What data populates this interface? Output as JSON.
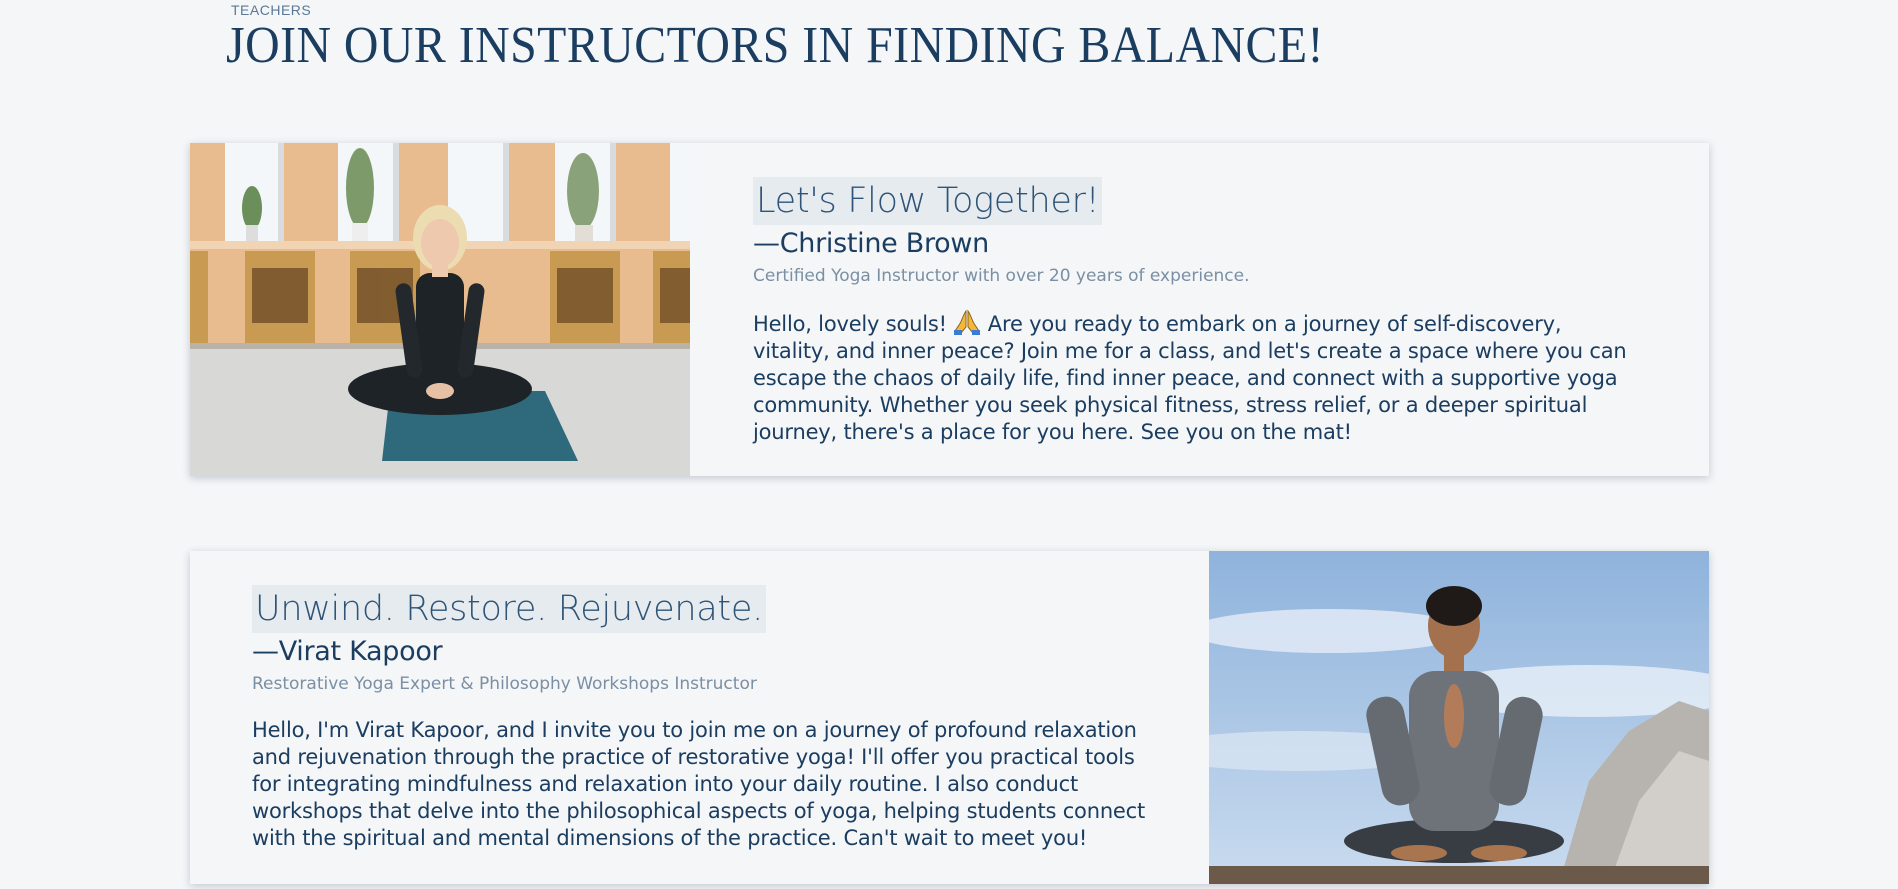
{
  "header": {
    "section_label": "TEACHERS",
    "title": "JOIN OUR INSTRUCTORS IN FINDING BALANCE!"
  },
  "instructors": [
    {
      "tagline": "Let's Flow Together!",
      "name": "—Christine Brown",
      "credentials": "Certified Yoga Instructor with over 20 years of experience.",
      "bio_before_emoji": "Hello, lovely souls! ",
      "bio_after_emoji": " Are you ready to embark on a journey of self-discovery, vitality, and inner peace? Join me for a class, and let's create a space where you can escape the chaos of daily life, find inner peace, and connect with a supportive yoga community. Whether you seek physical fitness, stress relief, or a deeper spiritual journey, there's a place for you here. See you on the mat!",
      "emoji_icon": "folded-hands-icon",
      "photo_position": "left"
    },
    {
      "tagline": "Unwind. Restore. Rejuvenate.",
      "name": "—Virat Kapoor",
      "credentials": "Restorative Yoga Expert & Philosophy Workshops Instructor",
      "bio": "Hello, I'm Virat Kapoor, and I invite you to join me on a journey of profound relaxation and rejuvenation through the practice of restorative yoga! I'll offer you practical tools for integrating mindfulness and relaxation into your daily routine. I also conduct workshops that delve into the philosophical aspects of yoga, helping students connect with the spiritual and mental dimensions of the practice. Can't wait to meet you!",
      "photo_position": "right"
    }
  ],
  "colors": {
    "background": "#f4f6f8",
    "heading": "#1b3d60",
    "tagline_highlight": "#e6ebef",
    "muted_text": "#7a8fa3"
  }
}
